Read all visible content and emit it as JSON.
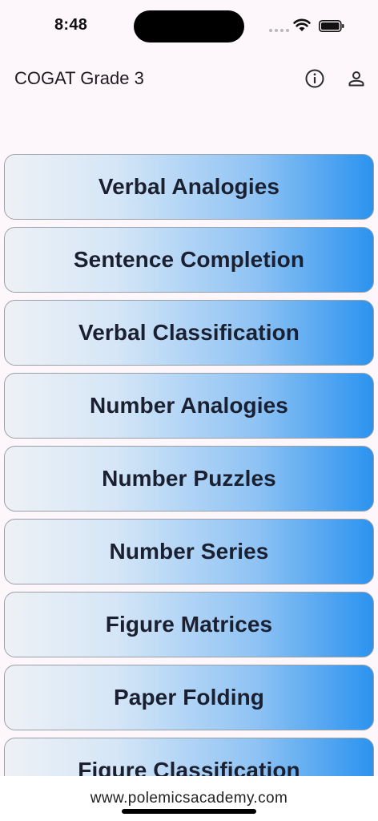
{
  "status_bar": {
    "time": "8:48"
  },
  "app_bar": {
    "title": "COGAT Grade 3",
    "info_icon": "info-circle-icon",
    "profile_icon": "person-icon"
  },
  "categories": [
    {
      "label": "Verbal Analogies"
    },
    {
      "label": "Sentence Completion"
    },
    {
      "label": "Verbal Classification"
    },
    {
      "label": "Number Analogies"
    },
    {
      "label": "Number Puzzles"
    },
    {
      "label": "Number Series"
    },
    {
      "label": "Figure Matrices"
    },
    {
      "label": "Paper Folding"
    },
    {
      "label": "Figure Classification"
    }
  ],
  "footer": {
    "link": "www.polemicsacademy.com"
  },
  "colors": {
    "background": "#fdf7fb",
    "gradient_start": "#eef1f5",
    "gradient_end": "#2b93ef"
  }
}
